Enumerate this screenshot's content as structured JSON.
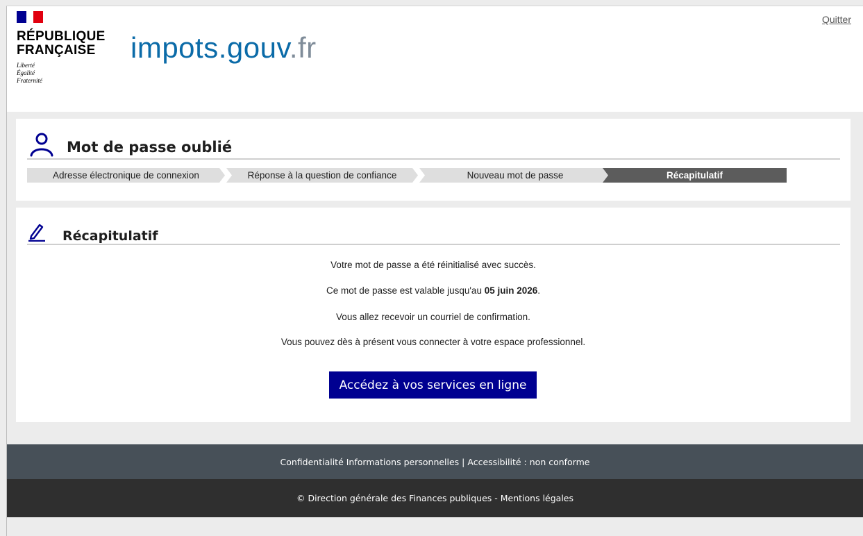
{
  "header": {
    "gov_name_line1": "RÉPUBLIQUE",
    "gov_name_line2": "FRANÇAISE",
    "motto_1": "Liberté",
    "motto_2": "Égalité",
    "motto_3": "Fraternité",
    "site_logo_name": "impots",
    "site_logo_gouv": ".gouv",
    "site_logo_fr": ".fr",
    "quit_label": "Quitter"
  },
  "page": {
    "title": "Mot de passe oublié",
    "steps": [
      {
        "label": "Adresse électronique de connexion",
        "active": false
      },
      {
        "label": "Réponse à la question de confiance",
        "active": false
      },
      {
        "label": "Nouveau mot de passe",
        "active": false
      },
      {
        "label": "Récapitulatif",
        "active": true
      }
    ]
  },
  "summary": {
    "title": "Récapitulatif",
    "line1": "Votre mot de passe a été réinitialisé avec succès.",
    "line2_prefix": "Ce mot de passe est valable jusqu'au ",
    "line2_date": "05 juin 2026",
    "line2_suffix": ".",
    "line3": "Vous allez recevoir un courriel de confirmation.",
    "line4": "Vous pouvez dès à présent vous connecter à votre espace professionnel.",
    "cta_label": "Accédez à vos services en ligne"
  },
  "footer": {
    "privacy_link": "Confidentialité Informations personnelles",
    "separator": " | ",
    "accessibility_link": "Accessibilité : non conforme",
    "copyright_prefix": "© Direction générale des Finances publiques - ",
    "legal_link": "Mentions légales"
  },
  "colors": {
    "brand_blue": "#000091",
    "flag_red": "#e1000f",
    "logo_blue": "#0b6ba8",
    "active_step": "#5c5c5c",
    "footer_top": "#475058",
    "footer_bottom": "#2f2f2f"
  },
  "icons": {
    "title_icon": "user-icon",
    "section_icon": "pencil-icon"
  }
}
